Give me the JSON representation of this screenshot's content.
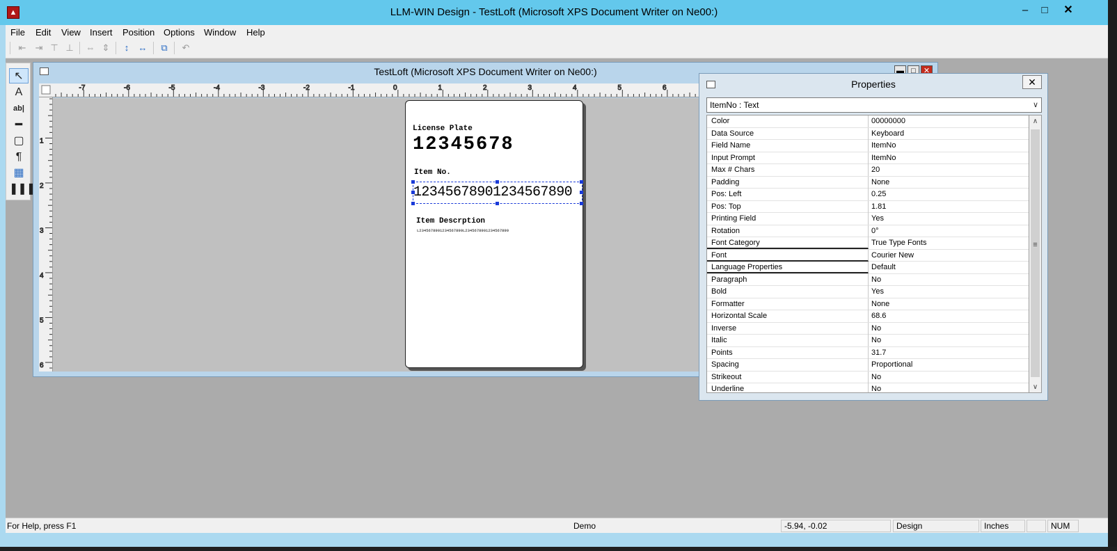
{
  "window": {
    "app_icon": "app-logo-icon",
    "title": "LLM-WIN Design - TestLoft (Microsoft XPS Document Writer on Ne00:)",
    "controls": {
      "minimize": "–",
      "maximize": "□",
      "close": "✕"
    }
  },
  "menu": [
    "File",
    "Edit",
    "View",
    "Insert",
    "Position",
    "Options",
    "Window",
    "Help"
  ],
  "toolbar": {
    "buttons": [
      "align-left-icon",
      "align-right-icon",
      "align-top-icon",
      "align-bottom-icon",
      "space-horizontal-icon",
      "space-vertical-icon",
      "center-vertical-icon",
      "center-horizontal-icon",
      "bring-front-icon",
      "undo-icon"
    ]
  },
  "toolbox": {
    "tools": [
      "pointer-tool-icon",
      "text-tool-icon",
      "text-field-tool-icon",
      "line-tool-icon",
      "rectangle-tool-icon",
      "paragraph-tool-icon",
      "image-tool-icon",
      "barcode-tool-icon"
    ],
    "selected": "pointer-tool-icon"
  },
  "document": {
    "title": "TestLoft (Microsoft XPS Document Writer on Ne00:)",
    "ruler_h": [
      "-7",
      "-6",
      "-5",
      "-4",
      "-3",
      "-2",
      "-1",
      "0",
      "1",
      "2",
      "3",
      "4",
      "5",
      "6"
    ],
    "ruler_v": [
      "1",
      "2",
      "3",
      "4",
      "5",
      "6"
    ],
    "label": {
      "plate_caption": "License Plate",
      "plate_value": "12345678",
      "item_caption": "Item No.",
      "item_value": "12345678901234567890",
      "desc_caption": "Item Descrption",
      "desc_value": "L2345678901234567890L2345678901234567890"
    }
  },
  "properties": {
    "title": "Properties",
    "close": "✕",
    "object": "ItemNo : Text",
    "rows": [
      {
        "name": "Color",
        "value": "00000000"
      },
      {
        "name": "Data Source",
        "value": "Keyboard"
      },
      {
        "name": "Field Name",
        "value": "ItemNo"
      },
      {
        "name": "Input Prompt",
        "value": "ItemNo"
      },
      {
        "name": "Max # Chars",
        "value": "20"
      },
      {
        "name": "Padding",
        "value": "None"
      },
      {
        "name": "Pos: Left",
        "value": "0.25"
      },
      {
        "name": "Pos: Top",
        "value": "1.81"
      },
      {
        "name": "Printing Field",
        "value": "Yes"
      },
      {
        "name": "Rotation",
        "value": "0°"
      },
      {
        "name": "Font Category",
        "value": "True Type Fonts"
      },
      {
        "name": "Font",
        "value": "Courier New"
      },
      {
        "name": "Language Properties",
        "value": "Default"
      },
      {
        "name": "Paragraph",
        "value": "No"
      },
      {
        "name": "Bold",
        "value": "Yes"
      },
      {
        "name": "Formatter",
        "value": "None"
      },
      {
        "name": "Horizontal Scale",
        "value": "68.6"
      },
      {
        "name": "Inverse",
        "value": "No"
      },
      {
        "name": "Italic",
        "value": "No"
      },
      {
        "name": "Points",
        "value": "31.7"
      },
      {
        "name": "Spacing",
        "value": "Proportional"
      },
      {
        "name": "Strikeout",
        "value": "No"
      },
      {
        "name": "Underline",
        "value": "No"
      }
    ]
  },
  "status": {
    "help": "For Help, press F1",
    "mode": "Demo",
    "coords": "-5.94, -0.02",
    "view": "Design",
    "units": "Inches",
    "blank": "",
    "num": "NUM"
  }
}
